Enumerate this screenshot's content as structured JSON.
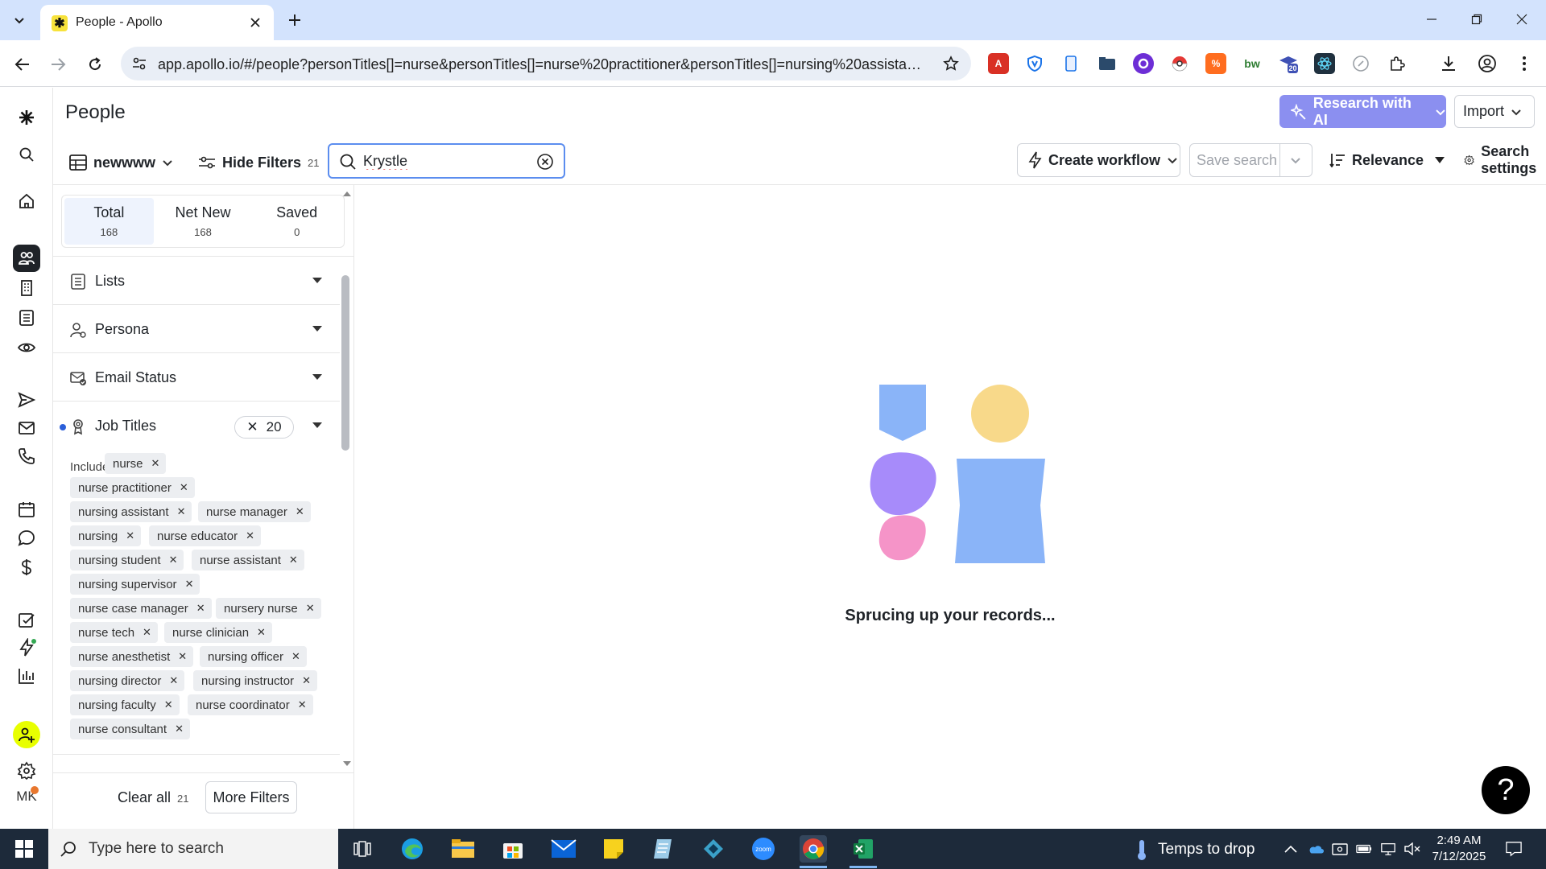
{
  "browser": {
    "tab_title": "People - Apollo",
    "url": "app.apollo.io/#/people?personTitles[]=nurse&personTitles[]=nurse%20practitioner&personTitles[]=nursing%20assistant&..."
  },
  "extensions": {
    "badge_count": "20"
  },
  "header": {
    "title": "People",
    "research_ai_label": "Research with AI",
    "import_label": "Import"
  },
  "subbar": {
    "view_name": "newwww",
    "hide_filters_label": "Hide Filters",
    "hide_filters_count": "21",
    "search_value": "Krystle",
    "create_workflow_label": "Create workflow",
    "save_search_label": "Save search",
    "sort_label": "Relevance",
    "search_settings_label": "Search settings"
  },
  "filters": {
    "count_tabs": [
      {
        "label": "Total",
        "count": "168"
      },
      {
        "label": "Net New",
        "count": "168"
      },
      {
        "label": "Saved",
        "count": "0"
      }
    ],
    "sections": [
      {
        "label": "Lists"
      },
      {
        "label": "Persona"
      },
      {
        "label": "Email Status"
      },
      {
        "label": "Job Titles",
        "badge": "20"
      }
    ],
    "include_label": "Include:",
    "job_titles": [
      "nurse",
      "nurse practitioner",
      "nursing assistant",
      "nurse manager",
      "nursing",
      "nurse educator",
      "nursing student",
      "nurse assistant",
      "nursing supervisor",
      "nurse case manager",
      "nursery nurse",
      "nurse tech",
      "nurse clinician",
      "nurse anesthetist",
      "nursing officer",
      "nursing director",
      "nursing instructor",
      "nursing faculty",
      "nurse coordinator",
      "nurse consultant"
    ],
    "clear_all_label": "Clear all",
    "clear_all_count": "21",
    "more_filters_label": "More Filters"
  },
  "main": {
    "loading_text": "Sprucing up your records..."
  },
  "nav": {
    "user_initials": "MK"
  },
  "taskbar": {
    "search_placeholder": "Type here to search",
    "weather_text": "Temps to drop",
    "time": "2:49 AM",
    "date": "7/12/2025"
  },
  "colors": {
    "accent": "#5b8def",
    "research_ai": "#8b8ff0",
    "tab_bar": "#d3e3fd",
    "taskbar": "#1d2a3a"
  }
}
